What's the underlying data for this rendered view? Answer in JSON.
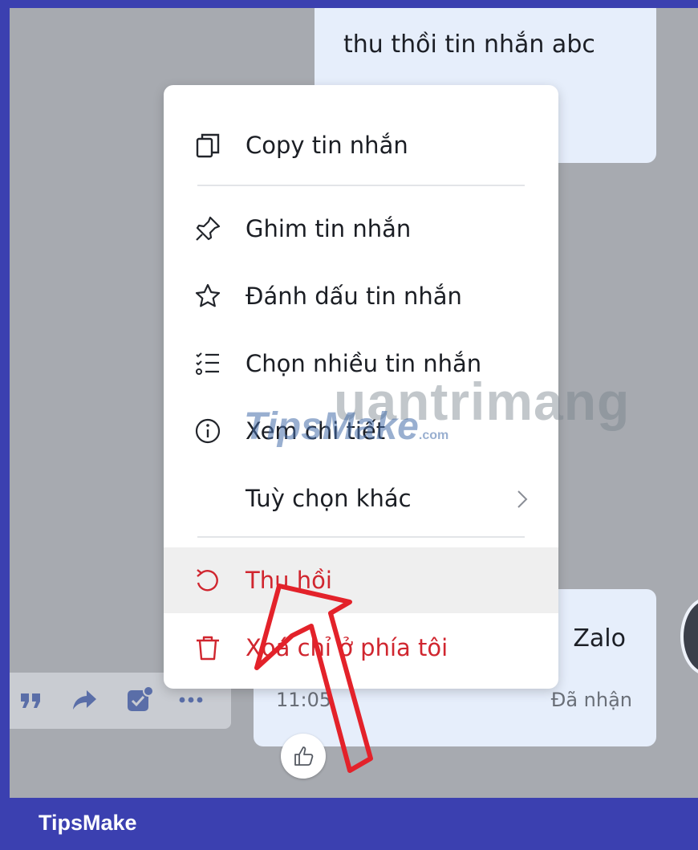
{
  "chat": {
    "top_message": "thu thồi tin nhắn abc",
    "bottom_message_snippet": "Zalo",
    "bottom_time": "11:05",
    "bottom_status": "Đã nhận"
  },
  "context_menu": {
    "items": [
      {
        "label": "Copy tin nhắn",
        "icon": "copy-icon"
      },
      {
        "label": "Ghim tin nhắn",
        "icon": "pin-icon"
      },
      {
        "label": "Đánh dấu tin nhắn",
        "icon": "star-icon"
      },
      {
        "label": "Chọn nhiều tin nhắn",
        "icon": "multi-select-icon"
      },
      {
        "label": "Xem chi tiết",
        "icon": "info-icon"
      },
      {
        "label": "Tuỳ chọn khác",
        "icon": "chevron-right-icon"
      },
      {
        "label": "Thu hồi",
        "icon": "recall-icon"
      },
      {
        "label": "Xoá chỉ ở phía tôi",
        "icon": "trash-icon"
      }
    ]
  },
  "watermark": {
    "line1": "uantrimang",
    "line2": "TipsMake",
    "line2_suffix": ".com"
  },
  "footer": {
    "brand": "TipsMake"
  },
  "colors": {
    "danger": "#d0262f",
    "frame": "#3b40b0",
    "annotation": "#e3222a"
  }
}
